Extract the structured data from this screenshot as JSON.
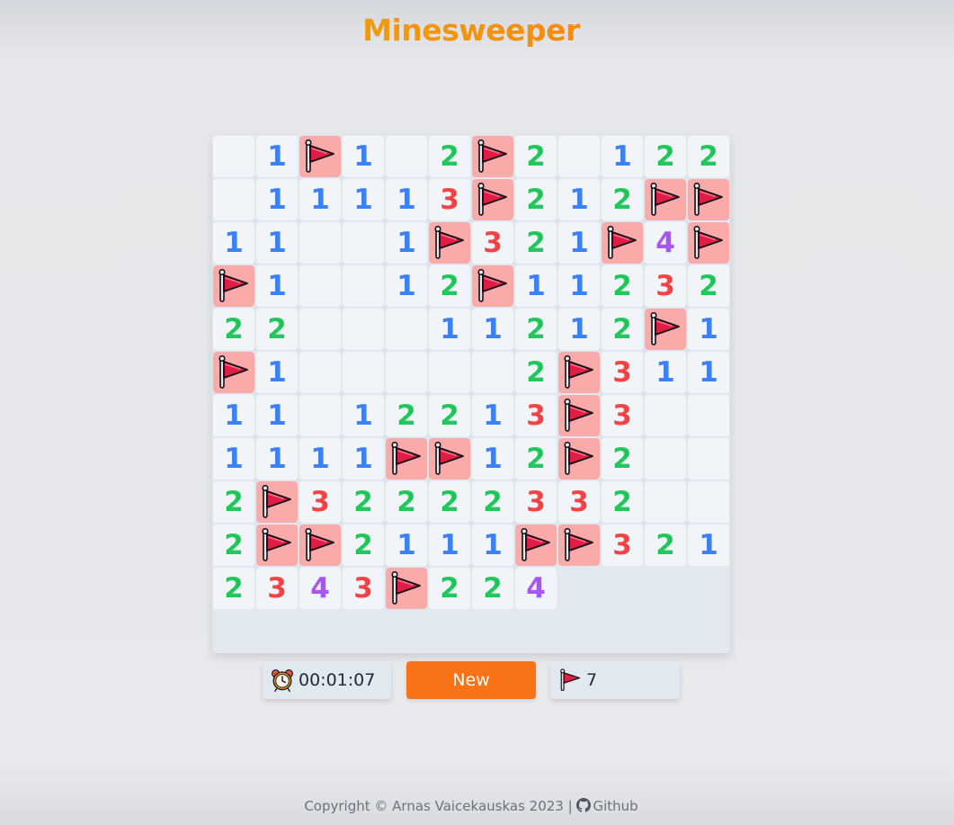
{
  "app": {
    "title": "Minesweeper"
  },
  "board": {
    "rows": 12,
    "cols": 12,
    "revealed_rows": [
      [
        "",
        "1",
        "F",
        "1",
        "",
        "2",
        "F",
        "2",
        "",
        "1",
        "2",
        "2"
      ],
      [
        "",
        "1",
        "1",
        "1",
        "1",
        "3",
        "F",
        "2",
        "1",
        "2",
        "F",
        "F"
      ],
      [
        "1",
        "1",
        "",
        "",
        "1",
        "F",
        "3",
        "2",
        "1",
        "F",
        "4",
        "F"
      ],
      [
        "F",
        "1",
        "",
        "",
        "1",
        "2",
        "F",
        "1",
        "1",
        "2",
        "3",
        "2"
      ],
      [
        "2",
        "2",
        "",
        "",
        "",
        "1",
        "1",
        "2",
        "1",
        "2",
        "F",
        "1"
      ],
      [
        "F",
        "1",
        "",
        "",
        "",
        "",
        "",
        "2",
        "F",
        "3",
        "1",
        "1"
      ],
      [
        "1",
        "1",
        "",
        "1",
        "2",
        "2",
        "1",
        "3",
        "F",
        "3",
        "",
        ""
      ],
      [
        "1",
        "1",
        "1",
        "1",
        "F",
        "F",
        "1",
        "2",
        "F",
        "2",
        "",
        ""
      ],
      [
        "2",
        "F",
        "3",
        "2",
        "2",
        "2",
        "2",
        "3",
        "3",
        "2",
        "",
        ""
      ],
      [
        "2",
        "F",
        "F",
        "2",
        "1",
        "1",
        "1",
        "F",
        "F",
        "3",
        "2",
        "1"
      ],
      [
        "2",
        "3",
        "4",
        "3",
        "F",
        "2",
        "2",
        "4",
        "?",
        "?",
        "?",
        "?"
      ],
      [
        "?",
        "?",
        "?",
        "?",
        "?",
        "?",
        "?",
        "?",
        "?",
        "?",
        "?",
        "?"
      ]
    ],
    "legend": {
      "F": "flag",
      "?": "unrevealed",
      "": "empty"
    },
    "number_colors": {
      "1": "#3b82f6",
      "2": "#22c55e",
      "3": "#ef4444",
      "4": "#a855f7"
    },
    "flag_icon": "flag-icon"
  },
  "controls": {
    "timer_icon": "alarm-clock-icon",
    "timer": "00:01:07",
    "new_label": "New",
    "flags_icon": "flag-icon",
    "flags_remaining": "7"
  },
  "footer": {
    "copyright": "Copyright © Arnas Vaicekauskas 2023 |",
    "github_icon": "github-icon",
    "github_label": "Github"
  },
  "colors": {
    "title_gradient_start": "#eab308",
    "title_gradient_end": "#f97316",
    "new_button": "#f97316",
    "flagged_cell": "#fbaaaa",
    "open_cell": "#f1f5f9",
    "unrevealed_cell": "#e2e8f0"
  }
}
